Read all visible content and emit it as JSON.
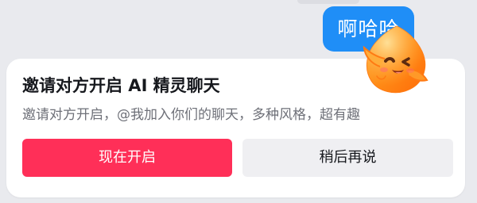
{
  "chat": {
    "message": "啊哈哈"
  },
  "prompt_card": {
    "title": "邀请对方开启 AI 精灵聊天",
    "subtitle": "邀请对方开启，@我加入你们的聊天，多种风格，超有趣",
    "primary_button": "现在开启",
    "secondary_button": "稍后再说"
  },
  "mascot": {
    "icon": "peach-sprite-mascot-icon"
  },
  "colors": {
    "bubble": "#1f8ef7",
    "primary": "#ff2f58",
    "secondary": "#efeff2",
    "background": "#e9eaee",
    "card": "#ffffff"
  }
}
